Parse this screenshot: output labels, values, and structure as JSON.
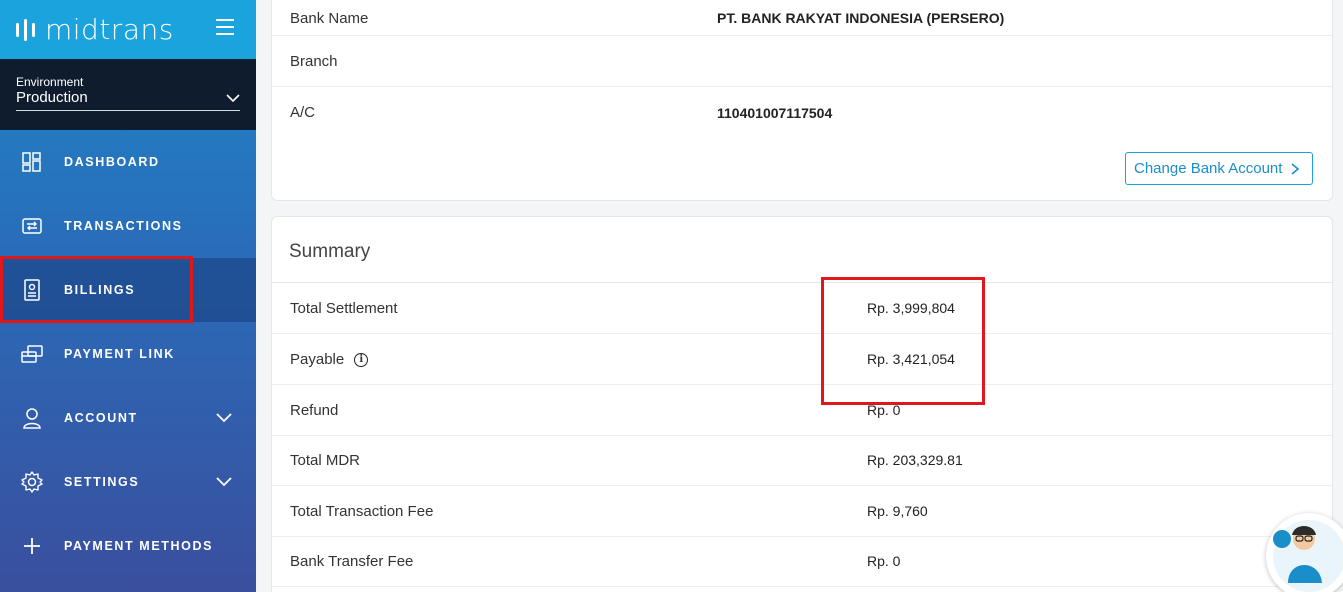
{
  "brand": {
    "name": "midtrans"
  },
  "environment": {
    "label": "Environment",
    "value": "Production"
  },
  "nav": {
    "items": [
      {
        "label": "DASHBOARD",
        "icon": "dashboard-icon"
      },
      {
        "label": "TRANSACTIONS",
        "icon": "transactions-icon"
      },
      {
        "label": "BILLINGS",
        "icon": "billing-icon"
      },
      {
        "label": "PAYMENT LINK",
        "icon": "payment-link-icon"
      },
      {
        "label": "ACCOUNT",
        "icon": "user-icon"
      },
      {
        "label": "SETTINGS",
        "icon": "gear-icon"
      },
      {
        "label": "PAYMENT METHODS",
        "icon": "plus-icon"
      }
    ]
  },
  "bank": {
    "rows": [
      {
        "key": "Bank Name",
        "value": "PT. BANK RAKYAT INDONESIA (PERSERO)"
      },
      {
        "key": "Branch",
        "value": ""
      },
      {
        "key": "A/C",
        "value": "110401007117504"
      }
    ],
    "change_button": "Change Bank Account"
  },
  "summary": {
    "title": "Summary",
    "rows": [
      {
        "key": "Total Settlement",
        "value": "Rp. 3,999,804"
      },
      {
        "key": "Payable",
        "value": "Rp. 3,421,054"
      },
      {
        "key": "Refund",
        "value": "Rp. 0"
      },
      {
        "key": "Total MDR",
        "value": "Rp. 203,329.81"
      },
      {
        "key": "Total Transaction Fee",
        "value": "Rp. 9,760"
      },
      {
        "key": "Bank Transfer Fee",
        "value": "Rp. 0"
      }
    ]
  },
  "colors": {
    "accent": "#1aa3dc",
    "highlight": "#e0181b",
    "env_bg": "#0f1c2e"
  }
}
